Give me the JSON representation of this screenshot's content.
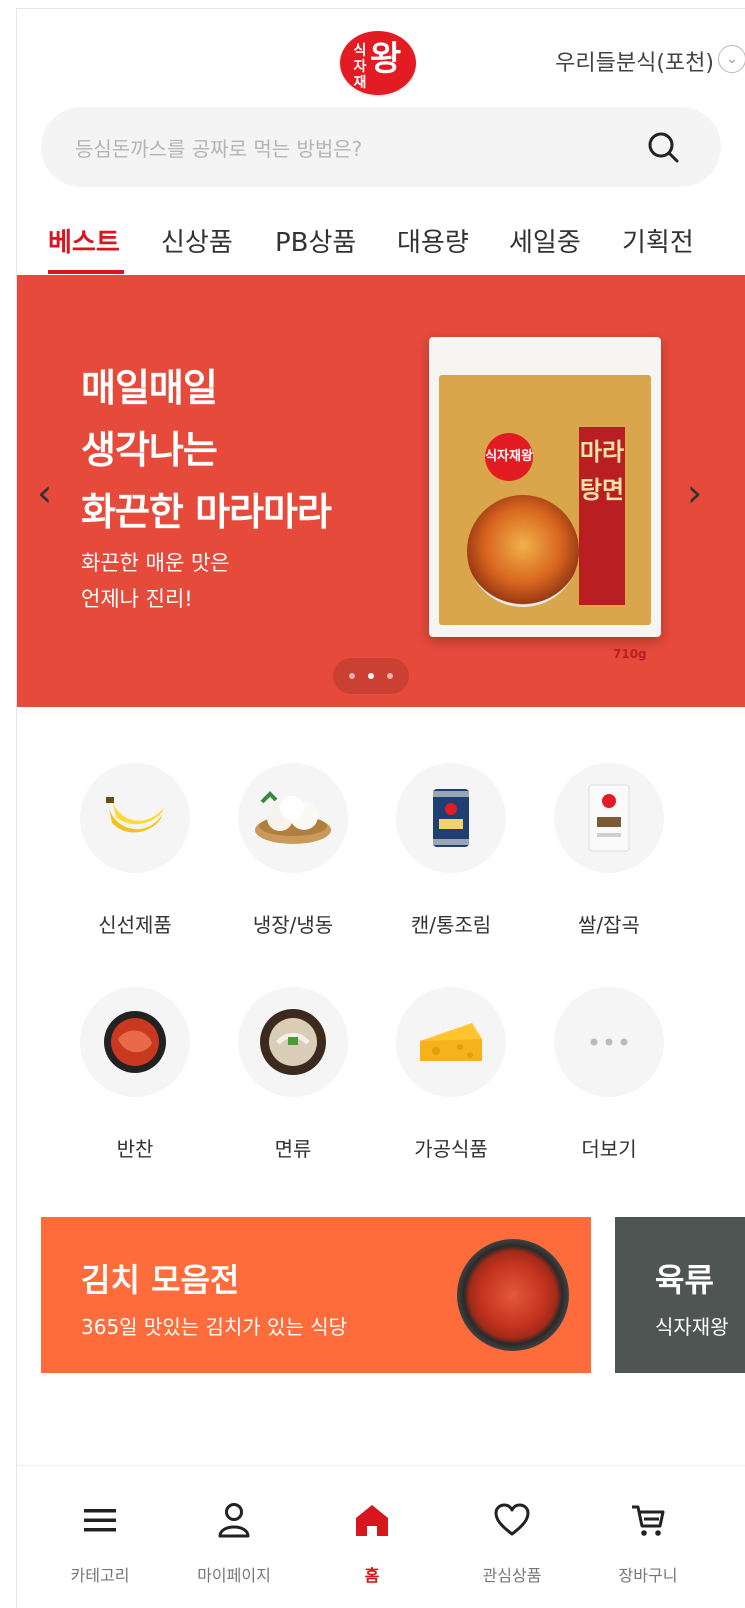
{
  "header": {
    "logo_text_small": "식자재",
    "logo_text_big": "왕",
    "store_name": "우리들분식(포천)"
  },
  "search": {
    "placeholder": "등심돈까스를 공짜로 먹는 방법은?"
  },
  "tabs": [
    {
      "label": "베스트",
      "active": true
    },
    {
      "label": "신상품"
    },
    {
      "label": "PB상품"
    },
    {
      "label": "대용량"
    },
    {
      "label": "세일중"
    },
    {
      "label": "기획전"
    }
  ],
  "banner": {
    "title_line1": "매일매일",
    "title_line2": "생각나는",
    "title_line3": "화끈한 마라마라",
    "subtitle_line1": "화끈한 매운 맛은",
    "subtitle_line2": "언제나 진리!",
    "product_panel": "마라탕면",
    "product_weight": "710g",
    "page_current": 2,
    "page_total": 3,
    "bg_color": "#e64a3b"
  },
  "categories": [
    {
      "label": "신선제품",
      "icon": "banana-icon"
    },
    {
      "label": "냉장/냉동",
      "icon": "dumpling-icon"
    },
    {
      "label": "캔/통조림",
      "icon": "can-icon"
    },
    {
      "label": "쌀/잡곡",
      "icon": "rice-bag-icon"
    },
    {
      "label": "반찬",
      "icon": "kimchi-icon"
    },
    {
      "label": "면류",
      "icon": "noodle-bowl-icon"
    },
    {
      "label": "가공식품",
      "icon": "cheese-icon"
    },
    {
      "label": "더보기",
      "icon": "more-icon"
    }
  ],
  "promos": [
    {
      "title": "김치 모음전",
      "subtitle": "365일 맛있는 김치가 있는 식당",
      "color": "#ff6c3b"
    },
    {
      "title": "육류 ",
      "subtitle": "식자재왕",
      "color": "#4f5552"
    }
  ],
  "bottom_nav": [
    {
      "label": "카테고리",
      "icon": "menu-icon"
    },
    {
      "label": "마이페이지",
      "icon": "user-icon"
    },
    {
      "label": "홈",
      "icon": "home-icon",
      "active": true
    },
    {
      "label": "관심상품",
      "icon": "heart-icon"
    },
    {
      "label": "장바구니",
      "icon": "cart-icon"
    }
  ],
  "colors": {
    "brand_red": "#d7161e",
    "banner_red": "#e64a3b",
    "promo_orange": "#ff6c3b"
  }
}
